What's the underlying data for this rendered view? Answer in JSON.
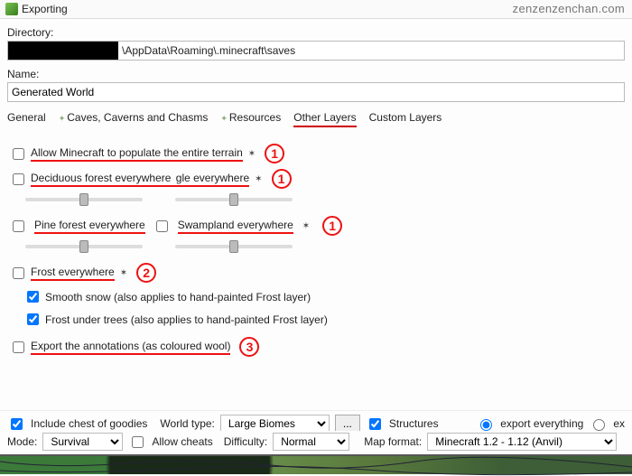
{
  "watermark": "zenzenzenchan.com",
  "window": {
    "title": "Exporting"
  },
  "fields": {
    "dir_label": "Directory:",
    "dir_suffix": "\\AppData\\Roaming\\.minecraft\\saves",
    "name_label": "Name:",
    "name_value": "Generated World"
  },
  "tabs": {
    "general": "General",
    "caves": "Caves, Caverns and Chasms",
    "resources": "Resources",
    "other": "Other Layers",
    "custom": "Custom Layers"
  },
  "other": {
    "populate": "Allow Minecraft to populate the entire terrain",
    "deciduous": "Deciduous forest everywhere",
    "gle": "gle everywhere",
    "pine": "Pine forest everywhere",
    "swamp": "Swampland everywhere",
    "frost": "Frost everywhere",
    "smooth": "Smooth snow (also applies to hand-painted Frost layer)",
    "under": "Frost under trees (also applies to hand-painted Frost layer)",
    "export_annot": "Export the annotations (as coloured wool)"
  },
  "annot": {
    "one": "1",
    "two": "2",
    "three": "3"
  },
  "bottom": {
    "chest": "Include chest of goodies",
    "worldtype_label": "World type:",
    "worldtype_value": "Large Biomes",
    "ellipsis": "...",
    "structures": "Structures",
    "export_all": "export everything",
    "export_ex": "ex",
    "mode_label": "Mode:",
    "mode_value": "Survival",
    "cheats": "Allow cheats",
    "diff_label": "Difficulty:",
    "diff_value": "Normal",
    "mapfmt_label": "Map format:",
    "mapfmt_value": "Minecraft 1.2 - 1.12 (Anvil)"
  }
}
